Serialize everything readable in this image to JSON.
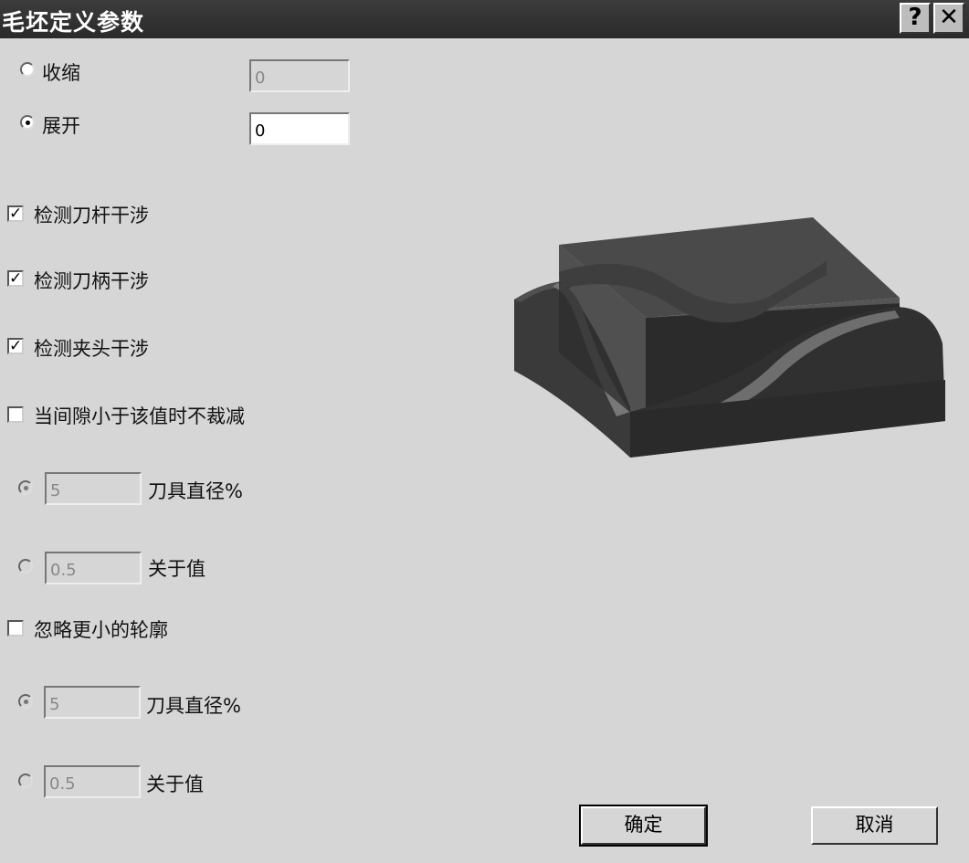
{
  "title": "毛坯定义参数",
  "title_buttons": {
    "help": "?",
    "close": "✕"
  },
  "mode": {
    "shrink_label": "收缩",
    "shrink_value": "0",
    "expand_label": "展开",
    "expand_value": "0"
  },
  "checks": {
    "shank_label": "检测刀杆干涉",
    "holder_label": "检测刀柄干涉",
    "chuck_label": "检测夹头干涉",
    "gap_label": "当间隙小于该值时不裁减",
    "ignore_label": "忽略更小的轮廓",
    "mark": "✓"
  },
  "gap": {
    "pct_value": "5",
    "pct_label": "刀具直径%",
    "abs_value": "0.5",
    "abs_label": "关于值"
  },
  "ignore": {
    "pct_value": "5",
    "pct_label": "刀具直径%",
    "abs_value": "0.5",
    "abs_label": "关于值"
  },
  "buttons": {
    "ok": "确定",
    "cancel": "取消"
  }
}
